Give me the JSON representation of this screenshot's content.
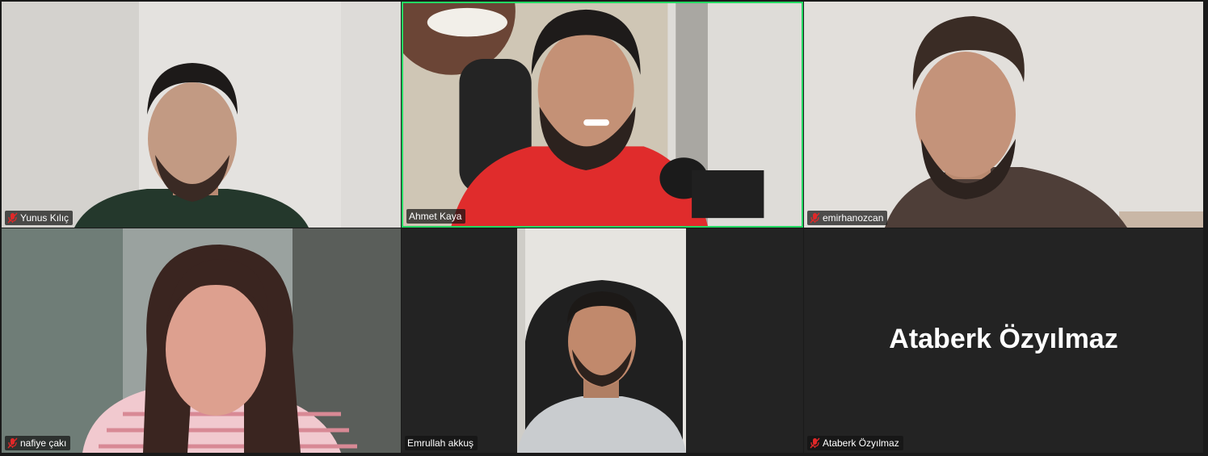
{
  "meeting": {
    "participants": [
      {
        "name": "Yunus Kılıç",
        "muted": true,
        "video": true
      },
      {
        "name": "Ahmet Kaya",
        "muted": false,
        "video": true,
        "active_speaker": true
      },
      {
        "name": "emirhanozcan",
        "muted": true,
        "video": true
      },
      {
        "name": "nafiye çakı",
        "muted": true,
        "video": true
      },
      {
        "name": "Emrullah akkuş",
        "muted": false,
        "video": true
      },
      {
        "name": "Ataberk Özyılmaz",
        "muted": true,
        "video": false,
        "display_name": "Ataberk Özyılmaz"
      }
    ]
  },
  "colors": {
    "active_border": "#23d962",
    "muted_icon": "#e02828",
    "tile_background": "#232323"
  }
}
